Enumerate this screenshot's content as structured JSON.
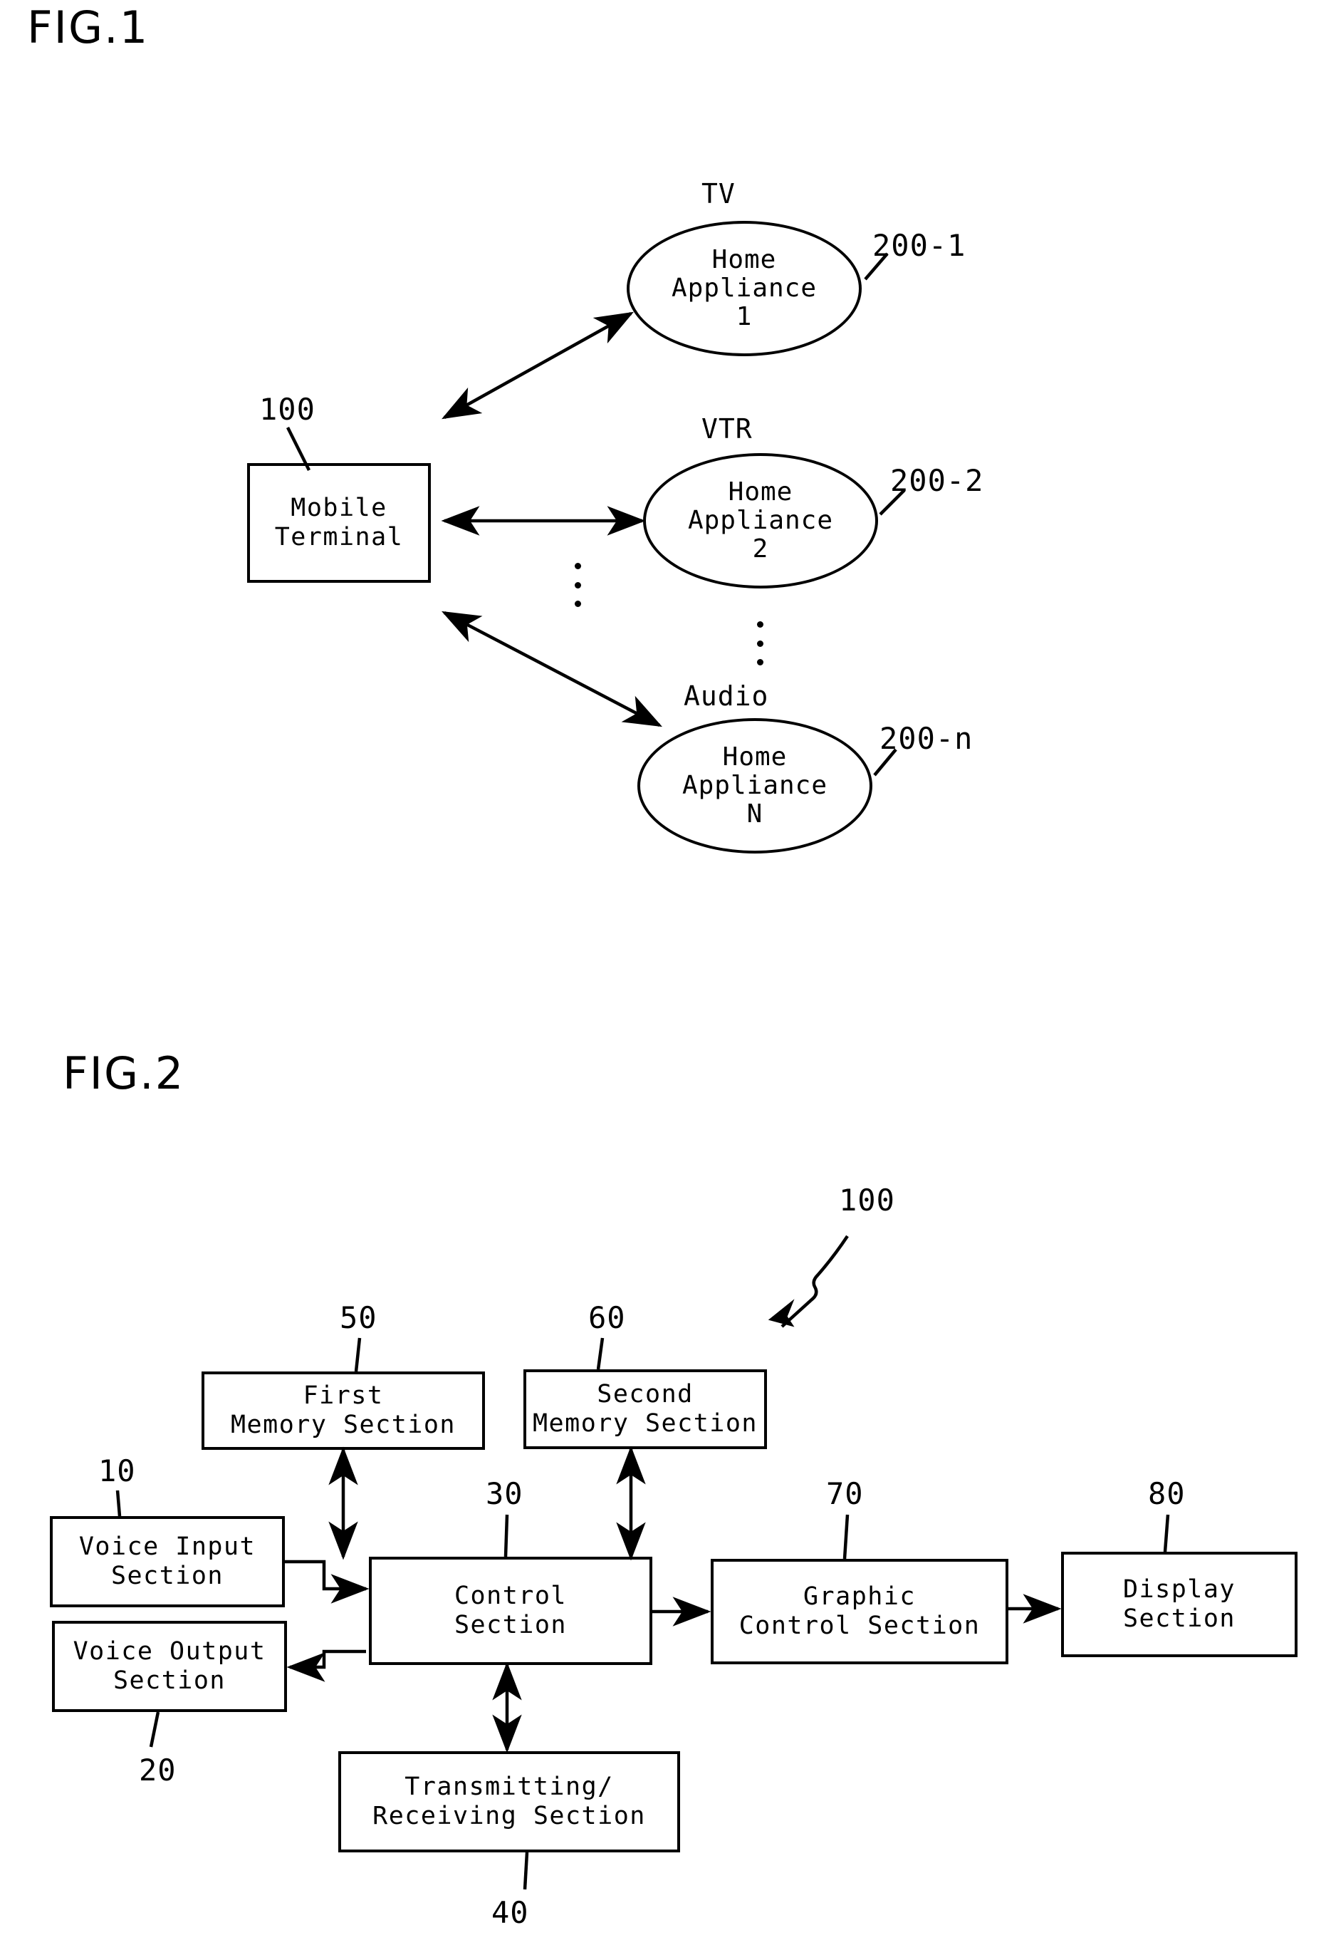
{
  "figures": [
    {
      "id": "fig1",
      "title": "FIG.1",
      "terminal": {
        "ref": "100",
        "line1": "Mobile",
        "line2": "Terminal"
      },
      "appliances": [
        {
          "caption": "TV",
          "line1": "Home",
          "line2": "Appliance",
          "line3": "1",
          "ref": "200-1"
        },
        {
          "caption": "VTR",
          "line1": "Home",
          "line2": "Appliance",
          "line3": "2",
          "ref": "200-2"
        },
        {
          "caption": "Audio",
          "line1": "Home",
          "line2": "Appliance",
          "line3": "N",
          "ref": "200-n"
        }
      ],
      "ellipsis": "⋮"
    },
    {
      "id": "fig2",
      "title": "FIG.2",
      "system_ref": "100",
      "blocks": [
        {
          "key": "voice_input",
          "ref": "10",
          "line1": "Voice Input",
          "line2": "Section"
        },
        {
          "key": "voice_output",
          "ref": "20",
          "line1": "Voice Output",
          "line2": "Section"
        },
        {
          "key": "control",
          "ref": "30",
          "line1": "Control",
          "line2": "Section"
        },
        {
          "key": "transceiver",
          "ref": "40",
          "line1": "Transmitting/",
          "line2": "Receiving Section"
        },
        {
          "key": "first_memory",
          "ref": "50",
          "line1": "First",
          "line2": "Memory Section"
        },
        {
          "key": "second_memory",
          "ref": "60",
          "line1": "Second",
          "line2": "Memory Section"
        },
        {
          "key": "graphic",
          "ref": "70",
          "line1": "Graphic",
          "line2": "Control Section"
        },
        {
          "key": "display",
          "ref": "80",
          "line1": "Display",
          "line2": "Section"
        }
      ]
    }
  ],
  "colors": {
    "ink": "#000000",
    "paper": "#ffffff"
  }
}
